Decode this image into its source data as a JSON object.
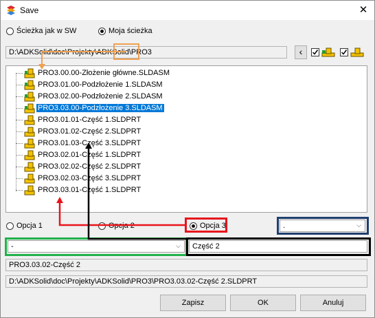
{
  "window": {
    "title": "Save",
    "close_glyph": "✕"
  },
  "path_mode": {
    "option_sw": "Ścieżka jak w SW",
    "option_mine": "Moja ścieżka",
    "selected": "option_mine"
  },
  "path_bar": {
    "prefix": "D:\\ADKSolid\\doc\\Projekty\\ADKSolid\\",
    "folder": "PRO3",
    "back_glyph": "‹"
  },
  "tree": {
    "items": [
      {
        "label": "PRO3.00.00-Złożenie główne.SLDASM",
        "type": "assembly-root",
        "selected": false
      },
      {
        "label": "PRO3.01.00-Podzłożenie 1.SLDASM",
        "type": "assembly",
        "selected": false
      },
      {
        "label": "PRO3.02.00-Podzłożenie 2.SLDASM",
        "type": "assembly",
        "selected": false
      },
      {
        "label": "PRO3.03.00-Podzłożenie 3.SLDASM",
        "type": "assembly",
        "selected": true
      },
      {
        "label": "PRO3.01.01-Część 1.SLDPRT",
        "type": "part",
        "selected": false
      },
      {
        "label": "PRO3.01.02-Część 2.SLDPRT",
        "type": "part",
        "selected": false
      },
      {
        "label": "PRO3.01.03-Część 3.SLDPRT",
        "type": "part",
        "selected": false
      },
      {
        "label": "PRO3.02.01-Część 1.SLDPRT",
        "type": "part",
        "selected": false
      },
      {
        "label": "PRO3.02.02-Część 2.SLDPRT",
        "type": "part",
        "selected": false
      },
      {
        "label": "PRO3.02.03-Część 3.SLDPRT",
        "type": "part",
        "selected": false
      },
      {
        "label": "PRO3.03.01-Część 1.SLDPRT",
        "type": "part",
        "selected": false
      }
    ]
  },
  "options": {
    "opcja1": "Opcja 1",
    "opcja2": "Opcja 2",
    "opcja3": "Opcja 3",
    "selected": "opcja3",
    "right_dropdown_value": "."
  },
  "name_row": {
    "dropdown_value": "-",
    "name_value": "Część 2"
  },
  "result": {
    "file_name": "PRO3.03.02-Część 2",
    "full_path": "D:\\ADKSolid\\doc\\Projekty\\ADKSolid\\PRO3\\PRO3.03.02-Część 2.SLDPRT"
  },
  "buttons": {
    "save": "Zapisz",
    "ok": "OK",
    "cancel": "Anuluj"
  },
  "colors": {
    "orange": "#f0a050",
    "red": "#e8141c",
    "black": "#000000",
    "green": "#22b14c",
    "navy": "#1f3f70",
    "selection": "#0078d7"
  }
}
